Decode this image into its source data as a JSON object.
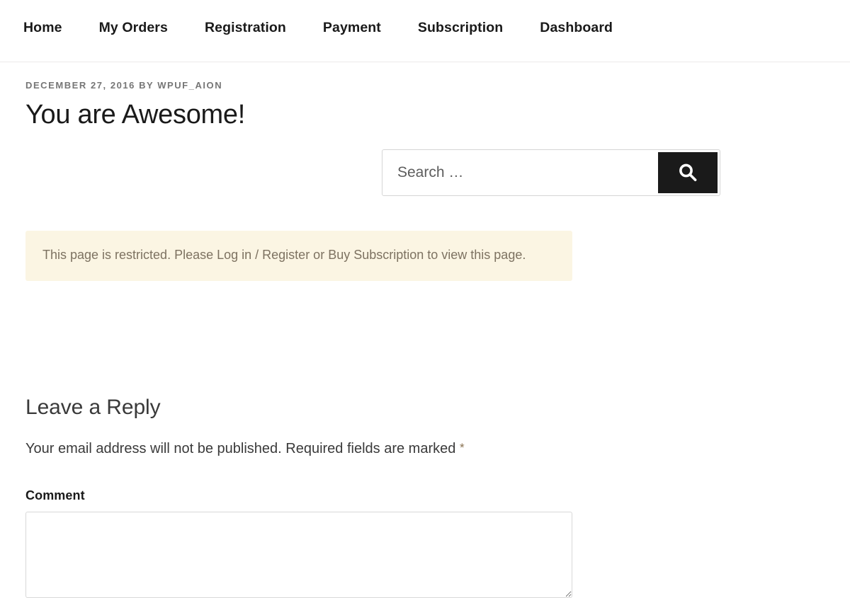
{
  "header": {
    "nav": [
      {
        "label": "Home",
        "name": "nav-item-home"
      },
      {
        "label": "My Orders",
        "name": "nav-item-my-orders"
      },
      {
        "label": "Registration",
        "name": "nav-item-registration"
      },
      {
        "label": "Payment",
        "name": "nav-item-payment"
      },
      {
        "label": "Subscription",
        "name": "nav-item-subscription"
      },
      {
        "label": "Dashboard",
        "name": "nav-item-dashboard"
      }
    ]
  },
  "entry": {
    "meta": "DECEMBER 27, 2016 BY WPUF_AION",
    "date": "DECEMBER 27, 2016",
    "author": "WPUF_AION",
    "title": "You are Awesome!"
  },
  "search": {
    "placeholder": "Search …",
    "value": "",
    "submit_icon": "search-icon",
    "button_color": "#1a1a1a"
  },
  "notice": {
    "text": "This page is restricted. Please Log in / Register or Buy Subscription to view this page.",
    "background": "#fbf5e3",
    "text_color": "#7d7261"
  },
  "comments": {
    "reply_title": "Leave a Reply",
    "notes": "Your email address will not be published. Required fields are marked",
    "required_symbol": "*",
    "required_color": "#8a7250",
    "comment_label": "Comment",
    "comment_value": "",
    "comment_placeholder": ""
  }
}
